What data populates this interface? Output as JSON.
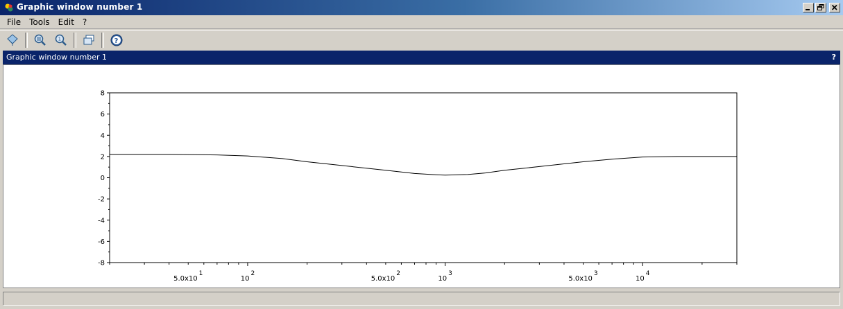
{
  "window": {
    "title": "Graphic window number 1",
    "buttons": [
      "minimize-icon",
      "restore-icon",
      "close-icon"
    ]
  },
  "menu": {
    "items": [
      "File",
      "Tools",
      "Edit",
      "?"
    ]
  },
  "toolbar": {
    "buttons": [
      {
        "name": "datatip-button",
        "icon": "datatip-icon"
      },
      {
        "name": "zoom-button",
        "icon": "zoom-icon"
      },
      {
        "name": "unzoom-button",
        "icon": "unzoom-icon"
      },
      {
        "name": "rotate-button",
        "icon": "rotate-icon"
      },
      {
        "name": "help-button",
        "icon": "help-icon"
      }
    ]
  },
  "dock": {
    "title": "Graphic window number 1",
    "help": "?"
  },
  "chart_data": {
    "type": "line",
    "xscale": "log",
    "xlim": [
      20,
      30000
    ],
    "ylim": [
      -8,
      8
    ],
    "yticks": [
      -8,
      -6,
      -4,
      -2,
      0,
      2,
      4,
      6,
      8
    ],
    "xtick_labels": [
      {
        "x": 50,
        "base": "5.0x10",
        "exp": "1"
      },
      {
        "x": 100,
        "base": "10",
        "exp": "2"
      },
      {
        "x": 500,
        "base": "5.0x10",
        "exp": "2"
      },
      {
        "x": 1000,
        "base": "10",
        "exp": "3"
      },
      {
        "x": 5000,
        "base": "5.0x10",
        "exp": "3"
      },
      {
        "x": 10000,
        "base": "10",
        "exp": "4"
      }
    ],
    "series": [
      {
        "color": "#000000",
        "x": [
          20,
          40,
          70,
          100,
          150,
          200,
          300,
          500,
          700,
          900,
          1000,
          1300,
          1600,
          2000,
          3000,
          5000,
          7000,
          10000,
          15000,
          20000,
          30000
        ],
        "y": [
          2.2,
          2.2,
          2.15,
          2.05,
          1.8,
          1.5,
          1.15,
          0.7,
          0.4,
          0.28,
          0.25,
          0.3,
          0.45,
          0.7,
          1.05,
          1.5,
          1.75,
          1.95,
          2.0,
          2.0,
          2.0
        ]
      }
    ]
  }
}
